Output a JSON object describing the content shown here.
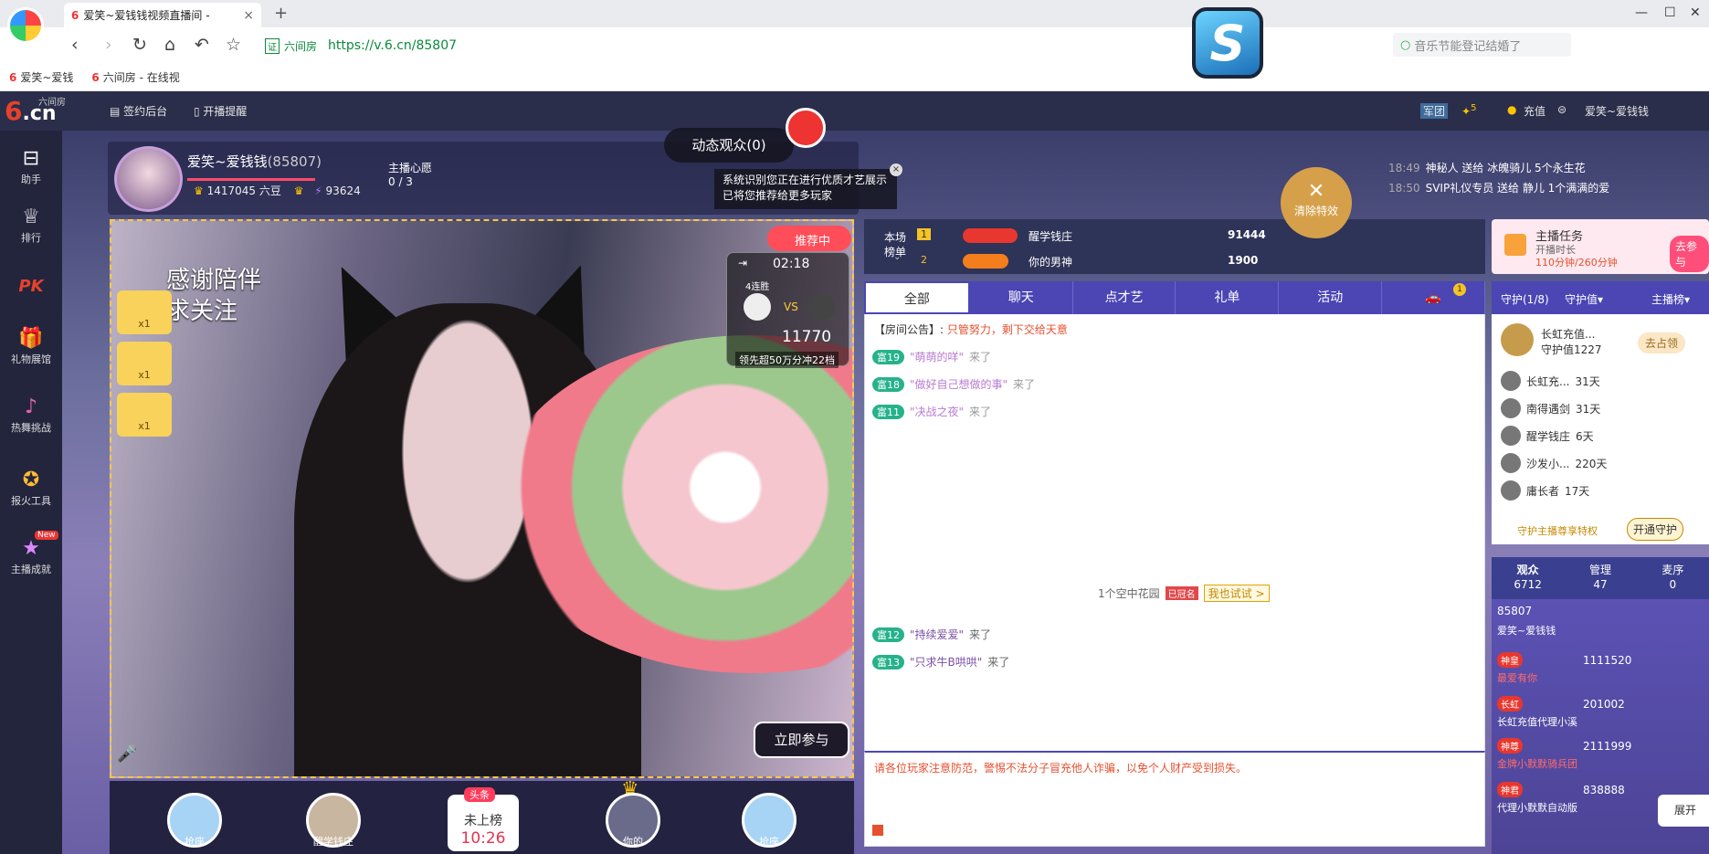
{
  "browser": {
    "tab_title": "爱笑~爱钱钱视频直播间 -",
    "tab_icon": "6",
    "url_site_label": "六间房",
    "url": "https://v.6.cn/85807",
    "search_placeholder": "音乐节能登记结婚了",
    "bookmarks": [
      "爱笑~爱钱",
      "六间房 - 在线视"
    ]
  },
  "site": {
    "logo_main": "6.cn",
    "logo_sub": "六间房",
    "header_links": [
      "签约后台",
      "开播提醒"
    ],
    "header_right": {
      "recharge": "充值",
      "user": "爱笑~爱钱钱",
      "army": "军团",
      "bag_count": "5"
    }
  },
  "left_nav": [
    "助手",
    "排行",
    "PK",
    "礼物展馆",
    "热舞挑战",
    "报火工具",
    "主播成就"
  ],
  "left_nav_new": "New",
  "anchor": {
    "name": "爱笑~爱钱钱",
    "room_id": "(85807)",
    "beans": "1417045 六豆",
    "fans": "93624",
    "wish_label": "主播心愿",
    "wish_progress": "0 / 3"
  },
  "overlay": {
    "dynamic_audience": "动态观众(0)",
    "notice_line1": "系统识别您正在进行优质才艺展示",
    "notice_line2": "已将您推荐给更多玩家",
    "clear_effects": "清除特效",
    "recommend": "推荐中",
    "thanks_line1": "感谢陪伴",
    "thanks_line2": "求关注",
    "gift_counts": [
      "x1",
      "x1",
      "x1"
    ],
    "pk": {
      "time": "02:18",
      "streak": "4连胜",
      "vs": "VS",
      "score": "11770",
      "board": "领先超50万分冲22档"
    },
    "join": "立即参与"
  },
  "seats": [
    {
      "label": "抢座"
    },
    {
      "label": "醒学钱庄"
    },
    {
      "label": "你的"
    },
    {
      "label": "抢座"
    }
  ],
  "rank_card": {
    "tag": "头条",
    "text": "未上榜",
    "time": "10:26"
  },
  "ranking": {
    "label_line1": "本场",
    "label_line2": "榜单",
    "rows": [
      {
        "rank": "1",
        "name": "醒学钱庄",
        "score": "91444"
      },
      {
        "rank": "2",
        "name": "你的男神",
        "score": "1900"
      }
    ]
  },
  "chat_tabs": [
    "全部",
    "聊天",
    "点才艺",
    "礼单",
    "活动",
    ""
  ],
  "chat_tab_badge": "1",
  "chat": {
    "announce_label": "【房间公告】:",
    "announce_text": "只管努力，剩下交给天意",
    "messages": [
      {
        "level": "富19",
        "name": "\"萌萌的咩\"",
        "text": "来了"
      },
      {
        "level": "富18",
        "name": "\"做好自己想做的事\"",
        "text": "来了"
      },
      {
        "level": "富11",
        "name": "\"决战之夜\"",
        "text": "来了"
      },
      {
        "level": "富12",
        "name": "\"持续爱爱\"",
        "text": "来了"
      },
      {
        "level": "富13",
        "name": "\"只求牛B哄哄\"",
        "text": "来了"
      }
    ],
    "try_text": "1个空中花园",
    "try_tag": "已冠名",
    "try_button": "我也试试 >",
    "warning": "请各位玩家注意防范，警惕不法分子冒充他人诈骗，以免个人财产受到损失。"
  },
  "feed": [
    {
      "time": "18:49",
      "text": "神秘人 送给 冰魄骑儿 5个永生花"
    },
    {
      "time": "18:50",
      "text": "SVIP礼仪专员 送给 静儿 1个满满的爱"
    }
  ],
  "task": {
    "title": "主播任务",
    "line1": "开播时长",
    "line2": "110分钟/260分钟",
    "go": "去参与"
  },
  "guard": {
    "tabs": [
      "守护(1/8)",
      "守护值▾",
      "主播榜▾"
    ],
    "top_name": "长虹充值...",
    "top_value": "守护值1227",
    "top_claim": "去占领",
    "rows": [
      {
        "name": "长虹充...",
        "days": "31天"
      },
      {
        "name": "南得遇剑",
        "days": "31天"
      },
      {
        "name": "醒学钱庄",
        "days": "6天"
      },
      {
        "name": "沙发小...",
        "days": "220天"
      },
      {
        "name": "庸长者",
        "days": "17天"
      }
    ],
    "footer_text": "守护主播尊享特权",
    "footer_button": "开通守护"
  },
  "audience_stats": [
    {
      "label": "观众",
      "value": "6712"
    },
    {
      "label": "管理",
      "value": "47"
    },
    {
      "label": "麦序",
      "value": "0"
    }
  ],
  "audience": [
    {
      "badge": "85807",
      "id": "",
      "name": "爱笑~爱钱钱"
    },
    {
      "badge": "神皇",
      "id": "1111520",
      "name": "最爱有你"
    },
    {
      "badge": "长虹",
      "id": "201002",
      "name": "长虹充值代理小溪"
    },
    {
      "badge": "神尊",
      "id": "2111999",
      "name": "金牌小默默骑兵团"
    },
    {
      "badge": "神君",
      "id": "838888",
      "name": "代理小默默自动版"
    }
  ],
  "expand": "展开"
}
